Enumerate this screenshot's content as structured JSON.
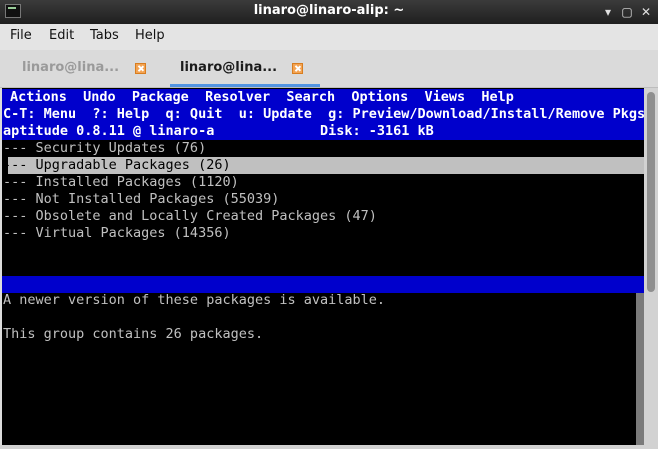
{
  "window": {
    "title": "linaro@linaro-alip: ~",
    "minimize_glyph": "▾",
    "maximize_glyph": "▢",
    "close_glyph": "✕"
  },
  "menubar": {
    "items": [
      {
        "label": "File"
      },
      {
        "label": "Edit"
      },
      {
        "label": "Tabs"
      },
      {
        "label": "Help"
      }
    ]
  },
  "tabs": [
    {
      "label": "linaro@lina...",
      "active": false
    },
    {
      "label": "linaro@lina...",
      "active": true
    }
  ],
  "terminal": {
    "menu_line": "Actions  Undo  Package  Resolver  Search  Options  Views  Help",
    "shortcut_line": "C-T: Menu  ?: Help  q: Quit  u: Update  g: Preview/Download/Install/Remove Pkgs",
    "status_line": "aptitude 0.8.11 @ linaro-a             Disk: -3161 kB",
    "groups": [
      {
        "label": "--- Security Updates (76)",
        "selected": false
      },
      {
        "label": "--- Upgradable Packages (26)",
        "selected": true
      },
      {
        "label": "--- Installed Packages (1120)",
        "selected": false
      },
      {
        "label": "--- Not Installed Packages (55039)",
        "selected": false
      },
      {
        "label": "--- Obsolete and Locally Created Packages (47)",
        "selected": false
      },
      {
        "label": "--- Virtual Packages (14356)",
        "selected": false
      }
    ],
    "description_line_1": "A newer version of these packages is available.",
    "description_line_2": "This group contains 26 packages."
  },
  "colors": {
    "terminal_bg": "#000000",
    "bar_blue": "#0000cc",
    "selection_grey": "#c0c0c0",
    "tab_accent": "#5294e2",
    "tab_close": "#f3a352"
  }
}
